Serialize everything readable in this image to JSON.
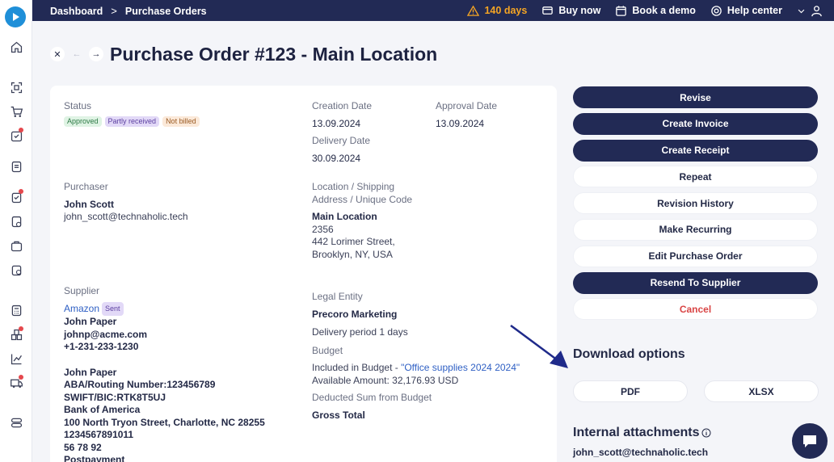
{
  "topbar": {
    "breadcrumbs": [
      "Dashboard",
      "Purchase Orders"
    ],
    "separator": ">",
    "trial": "140 days",
    "buy_now": "Buy now",
    "book_demo": "Book a demo",
    "help_center": "Help center"
  },
  "header": {
    "title": "Purchase Order #123 - Main Location"
  },
  "details": {
    "status_label": "Status",
    "badges": [
      "Approved",
      "Partly received",
      "Not billed"
    ],
    "creation_label": "Creation Date",
    "creation_value": "13.09.2024",
    "approval_label": "Approval Date",
    "approval_value": "13.09.2024",
    "delivery_label": "Delivery Date",
    "delivery_value": "30.09.2024",
    "purchaser_label": "Purchaser",
    "purchaser_name": "John Scott",
    "purchaser_email": "john_scott@technaholic.tech",
    "location_label_1": "Location / Shipping",
    "location_label_2": "Address / Unique Code",
    "location_name": "Main Location",
    "location_code": "2356",
    "location_street": "442 Lorimer Street,",
    "location_city": "Brooklyn, NY, USA",
    "supplier_label": "Supplier",
    "supplier_name": "Amazon",
    "supplier_badge": "Sent",
    "supplier_contact": "John Paper",
    "supplier_email": "johnp@acme.com",
    "supplier_phone": "+1-231-233-1230",
    "bank_contact": "John Paper",
    "bank_routing": "ABA/Routing Number:123456789",
    "bank_swift": "SWIFT/BIC:RTK8T5UJ",
    "bank_name": "Bank of America",
    "bank_address": "100 North Tryon Street, Charlotte, NC 28255",
    "bank_account": "1234567891011",
    "bank_extra": "56 78 92",
    "payment_terms": "Postpayment",
    "legal_label": "Legal Entity",
    "legal_value": "Precoro Marketing",
    "delivery_period": "Delivery period 1 days",
    "budget_label": "Budget",
    "budget_included_prefix": "Included in Budget - ",
    "budget_included_link": "\"Office supplies 2024 2024\"",
    "budget_available": "Available Amount: 32,176.93 USD",
    "deducted_label": "Deducted Sum from Budget",
    "deducted_value": "Gross Total"
  },
  "actions": {
    "revise": "Revise",
    "create_invoice": "Create Invoice",
    "create_receipt": "Create Receipt",
    "repeat": "Repeat",
    "revision_history": "Revision History",
    "make_recurring": "Make Recurring",
    "edit_po": "Edit Purchase Order",
    "resend": "Resend To Supplier",
    "cancel": "Cancel"
  },
  "download": {
    "title": "Download options",
    "pdf": "PDF",
    "xlsx": "XLSX"
  },
  "attachments": {
    "title": "Internal attachments",
    "email": "john_scott@technaholic.tech"
  },
  "colors": {
    "navy": "#222a55",
    "accent_blue": "#1f8fd8",
    "warning": "#f5a524",
    "danger": "#d94545",
    "link": "#2e5fc4"
  }
}
